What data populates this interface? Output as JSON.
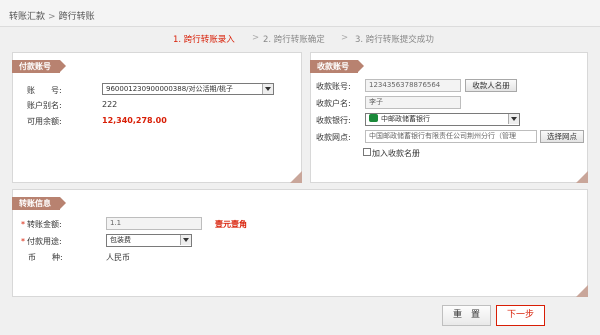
{
  "breadcrumb": {
    "parent": "转账汇款",
    "separator": ">",
    "current": "跨行转账"
  },
  "steps": [
    {
      "label": "1. 跨行转账录入"
    },
    {
      "label": "2. 跨行转账确定"
    },
    {
      "label": "3. 跨行转账提交成功"
    }
  ],
  "step_arrow": ">",
  "payer": {
    "tag": "付款账号",
    "account_label": "账　　号:",
    "account_value": "960001230900000388/对公活期/桃子",
    "alias_label": "账户别名:",
    "alias_value": "222",
    "balance_label": "可用余额:",
    "balance_value": "12,340,278.00"
  },
  "payee": {
    "tag": "收款账号",
    "account_label": "收款账号:",
    "account_value": "1234356378876564",
    "payee_book_button": "收款人名册",
    "name_label": "收款户名:",
    "name_value": "李子",
    "bank_label": "收款银行:",
    "bank_value": "中邮政储蓄银行",
    "branch_label": "收款网点:",
    "branch_value": "中国邮政储蓄银行有限责任公司荆州分行（管理",
    "select_branch_button": "选择网点",
    "add_to_book_label": "加入收款名册"
  },
  "transfer": {
    "tag": "转账信息",
    "required_mark": "*",
    "amount_label": "转账金额:",
    "amount_value": "1.1",
    "amount_in_words": "壹元壹角",
    "purpose_label": "付款用途:",
    "purpose_value": "包装费",
    "currency_label": "币　　种:",
    "currency_value": "人民币"
  },
  "actions": {
    "reset": "重　置",
    "next": "下一步"
  },
  "colors": {
    "accent": "#d81e06",
    "tag": "#b88270"
  },
  "icons": {
    "bank_logo": "postal-savings-bank-logo-icon"
  }
}
